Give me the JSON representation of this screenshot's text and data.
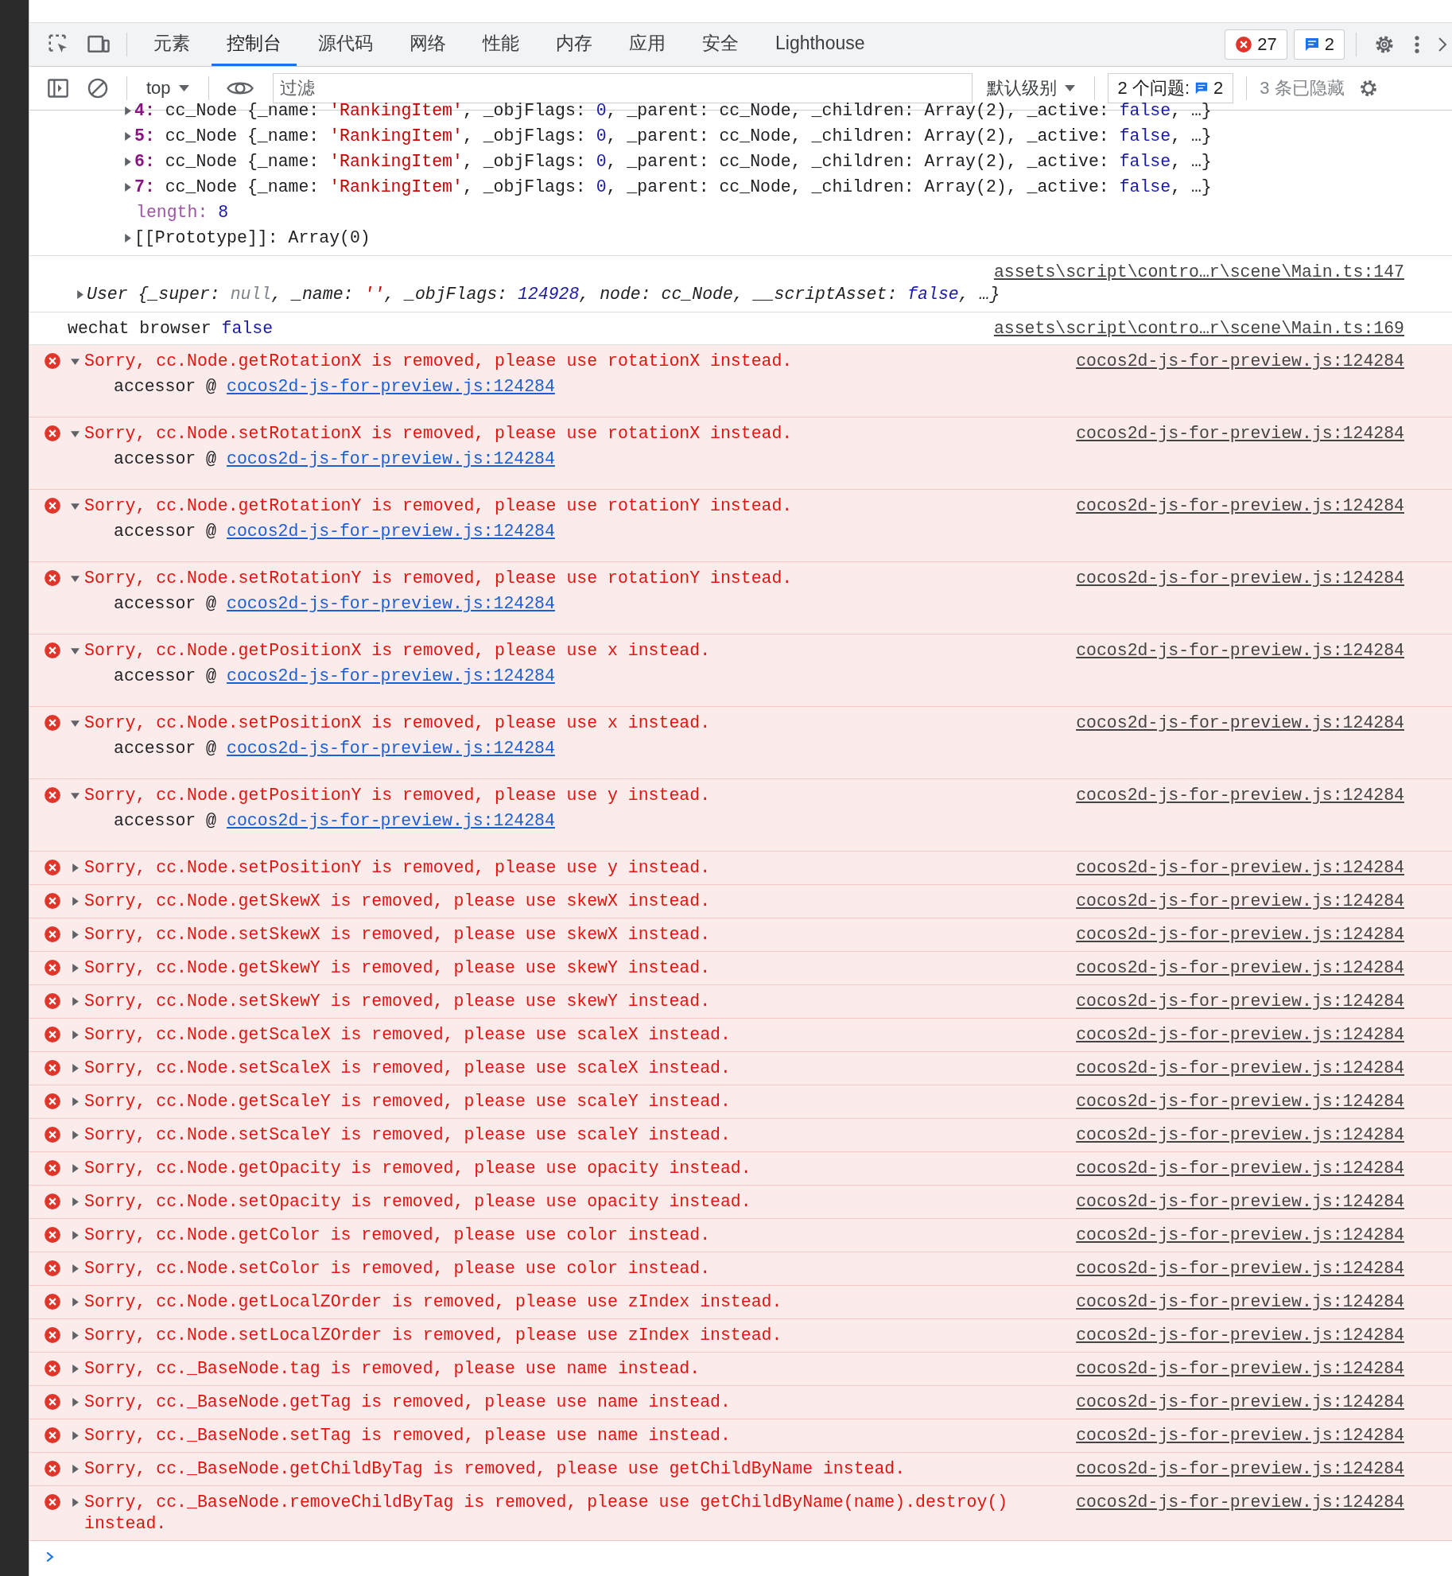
{
  "toolbar": {
    "tabs": [
      {
        "label": "元素",
        "selected": false
      },
      {
        "label": "控制台",
        "selected": true
      },
      {
        "label": "源代码",
        "selected": false
      },
      {
        "label": "网络",
        "selected": false
      },
      {
        "label": "性能",
        "selected": false
      },
      {
        "label": "内存",
        "selected": false
      },
      {
        "label": "应用",
        "selected": false
      },
      {
        "label": "安全",
        "selected": false
      },
      {
        "label": "Lighthouse",
        "selected": false
      }
    ],
    "error_count": "27",
    "message_count": "2"
  },
  "filter_bar": {
    "context": "top",
    "placeholder": "过滤",
    "level": "默认级别",
    "issues_label": "2 个问题:",
    "issues_count": "2",
    "hidden": "3 条已隐藏"
  },
  "console": {
    "entries": [
      {
        "kind": "tree",
        "lines": [
          {
            "key": "4:",
            "kind": "index",
            "expanded": false,
            "tokens": [
              {
                "kind": "plain",
                "text": " cc_Node {_name: "
              },
              {
                "kind": "string",
                "text": "'RankingItem'"
              },
              {
                "kind": "plain",
                "text": ", _objFlags: "
              },
              {
                "kind": "number",
                "text": "0"
              },
              {
                "kind": "plain",
                "text": ", _parent: cc_Node, _children: Array(2), _active: "
              },
              {
                "kind": "number",
                "text": "false"
              },
              {
                "kind": "plain",
                "text": ", …}"
              }
            ]
          },
          {
            "key": "5:",
            "kind": "index",
            "expanded": false,
            "tokens": [
              {
                "kind": "plain",
                "text": " cc_Node {_name: "
              },
              {
                "kind": "string",
                "text": "'RankingItem'"
              },
              {
                "kind": "plain",
                "text": ", _objFlags: "
              },
              {
                "kind": "number",
                "text": "0"
              },
              {
                "kind": "plain",
                "text": ", _parent: cc_Node, _children: Array(2), _active: "
              },
              {
                "kind": "number",
                "text": "false"
              },
              {
                "kind": "plain",
                "text": ", …}"
              }
            ]
          },
          {
            "key": "6:",
            "kind": "index",
            "expanded": false,
            "tokens": [
              {
                "kind": "plain",
                "text": " cc_Node {_name: "
              },
              {
                "kind": "string",
                "text": "'RankingItem'"
              },
              {
                "kind": "plain",
                "text": ", _objFlags: "
              },
              {
                "kind": "number",
                "text": "0"
              },
              {
                "kind": "plain",
                "text": ", _parent: cc_Node, _children: Array(2), _active: "
              },
              {
                "kind": "number",
                "text": "false"
              },
              {
                "kind": "plain",
                "text": ", …}"
              }
            ]
          },
          {
            "key": "7:",
            "kind": "index",
            "expanded": false,
            "tokens": [
              {
                "kind": "plain",
                "text": " cc_Node {_name: "
              },
              {
                "kind": "string",
                "text": "'RankingItem'"
              },
              {
                "kind": "plain",
                "text": ", _objFlags: "
              },
              {
                "kind": "number",
                "text": "0"
              },
              {
                "kind": "plain",
                "text": ", _parent: cc_Node, _children: Array(2), _active: "
              },
              {
                "kind": "number",
                "text": "false"
              },
              {
                "kind": "plain",
                "text": ", …}"
              }
            ]
          },
          {
            "key": "length:",
            "kind": "own",
            "tokens": [
              {
                "kind": "number",
                "text": " 8"
              }
            ]
          },
          {
            "key": "[[Prototype]]:",
            "kind": "internal",
            "expanded": false,
            "tokens": [
              {
                "kind": "plain",
                "text": " Array(0)"
              }
            ]
          }
        ]
      },
      {
        "kind": "object",
        "source": "assets\\script\\contro…r\\scene\\Main.ts:147",
        "expanded": false,
        "tokens": [
          {
            "kind": "plain",
            "text": "User {_super: "
          },
          {
            "kind": "null",
            "text": "null"
          },
          {
            "kind": "plain",
            "text": ", _name: "
          },
          {
            "kind": "string",
            "text": "''"
          },
          {
            "kind": "plain",
            "text": ", _objFlags: "
          },
          {
            "kind": "number",
            "text": "124928"
          },
          {
            "kind": "plain",
            "text": ", node: cc_Node, __scriptAsset: "
          },
          {
            "kind": "number",
            "text": "false"
          },
          {
            "kind": "plain",
            "text": ", …}"
          }
        ]
      },
      {
        "kind": "log",
        "source": "assets\\script\\contro…r\\scene\\Main.ts:169",
        "tokens": [
          {
            "kind": "plain",
            "text": "wechat browser "
          },
          {
            "kind": "number",
            "text": "false"
          }
        ]
      },
      {
        "kind": "error",
        "expanded": true,
        "message": "Sorry, cc.Node.getRotationX is removed, please use rotationX instead.",
        "source": "cocos2d-js-for-preview.js:124284",
        "stack": [
          {
            "fn": "accessor @",
            "link": "cocos2d-js-for-preview.js:124284"
          }
        ]
      },
      {
        "kind": "error",
        "expanded": true,
        "message": "Sorry, cc.Node.setRotationX is removed, please use rotationX instead.",
        "source": "cocos2d-js-for-preview.js:124284",
        "stack": [
          {
            "fn": "accessor @",
            "link": "cocos2d-js-for-preview.js:124284"
          }
        ]
      },
      {
        "kind": "error",
        "expanded": true,
        "message": "Sorry, cc.Node.getRotationY is removed, please use rotationY instead.",
        "source": "cocos2d-js-for-preview.js:124284",
        "stack": [
          {
            "fn": "accessor @",
            "link": "cocos2d-js-for-preview.js:124284"
          }
        ]
      },
      {
        "kind": "error",
        "expanded": true,
        "message": "Sorry, cc.Node.setRotationY is removed, please use rotationY instead.",
        "source": "cocos2d-js-for-preview.js:124284",
        "stack": [
          {
            "fn": "accessor @",
            "link": "cocos2d-js-for-preview.js:124284"
          }
        ]
      },
      {
        "kind": "error",
        "expanded": true,
        "message": "Sorry, cc.Node.getPositionX is removed, please use x instead.",
        "source": "cocos2d-js-for-preview.js:124284",
        "stack": [
          {
            "fn": "accessor @",
            "link": "cocos2d-js-for-preview.js:124284"
          }
        ]
      },
      {
        "kind": "error",
        "expanded": true,
        "message": "Sorry, cc.Node.setPositionX is removed, please use x instead.",
        "source": "cocos2d-js-for-preview.js:124284",
        "stack": [
          {
            "fn": "accessor @",
            "link": "cocos2d-js-for-preview.js:124284"
          }
        ]
      },
      {
        "kind": "error",
        "expanded": true,
        "message": "Sorry, cc.Node.getPositionY is removed, please use y instead.",
        "source": "cocos2d-js-for-preview.js:124284",
        "stack": [
          {
            "fn": "accessor @",
            "link": "cocos2d-js-for-preview.js:124284"
          }
        ]
      },
      {
        "kind": "error",
        "expanded": false,
        "message": "Sorry, cc.Node.setPositionY is removed, please use y instead.",
        "source": "cocos2d-js-for-preview.js:124284"
      },
      {
        "kind": "error",
        "expanded": false,
        "message": "Sorry, cc.Node.getSkewX is removed, please use skewX instead.",
        "source": "cocos2d-js-for-preview.js:124284"
      },
      {
        "kind": "error",
        "expanded": false,
        "message": "Sorry, cc.Node.setSkewX is removed, please use skewX instead.",
        "source": "cocos2d-js-for-preview.js:124284"
      },
      {
        "kind": "error",
        "expanded": false,
        "message": "Sorry, cc.Node.getSkewY is removed, please use skewY instead.",
        "source": "cocos2d-js-for-preview.js:124284"
      },
      {
        "kind": "error",
        "expanded": false,
        "message": "Sorry, cc.Node.setSkewY is removed, please use skewY instead.",
        "source": "cocos2d-js-for-preview.js:124284"
      },
      {
        "kind": "error",
        "expanded": false,
        "message": "Sorry, cc.Node.getScaleX is removed, please use scaleX instead.",
        "source": "cocos2d-js-for-preview.js:124284"
      },
      {
        "kind": "error",
        "expanded": false,
        "message": "Sorry, cc.Node.setScaleX is removed, please use scaleX instead.",
        "source": "cocos2d-js-for-preview.js:124284"
      },
      {
        "kind": "error",
        "expanded": false,
        "message": "Sorry, cc.Node.getScaleY is removed, please use scaleY instead.",
        "source": "cocos2d-js-for-preview.js:124284"
      },
      {
        "kind": "error",
        "expanded": false,
        "message": "Sorry, cc.Node.setScaleY is removed, please use scaleY instead.",
        "source": "cocos2d-js-for-preview.js:124284"
      },
      {
        "kind": "error",
        "expanded": false,
        "message": "Sorry, cc.Node.getOpacity is removed, please use opacity instead.",
        "source": "cocos2d-js-for-preview.js:124284"
      },
      {
        "kind": "error",
        "expanded": false,
        "message": "Sorry, cc.Node.setOpacity is removed, please use opacity instead.",
        "source": "cocos2d-js-for-preview.js:124284"
      },
      {
        "kind": "error",
        "expanded": false,
        "message": "Sorry, cc.Node.getColor is removed, please use color instead.",
        "source": "cocos2d-js-for-preview.js:124284"
      },
      {
        "kind": "error",
        "expanded": false,
        "message": "Sorry, cc.Node.setColor is removed, please use color instead.",
        "source": "cocos2d-js-for-preview.js:124284"
      },
      {
        "kind": "error",
        "expanded": false,
        "message": "Sorry, cc.Node.getLocalZOrder is removed, please use zIndex instead.",
        "source": "cocos2d-js-for-preview.js:124284"
      },
      {
        "kind": "error",
        "expanded": false,
        "message": "Sorry, cc.Node.setLocalZOrder is removed, please use zIndex instead.",
        "source": "cocos2d-js-for-preview.js:124284"
      },
      {
        "kind": "error",
        "expanded": false,
        "message": "Sorry, cc._BaseNode.tag is removed, please use name instead.",
        "source": "cocos2d-js-for-preview.js:124284"
      },
      {
        "kind": "error",
        "expanded": false,
        "message": "Sorry, cc._BaseNode.getTag is removed, please use name instead.",
        "source": "cocos2d-js-for-preview.js:124284"
      },
      {
        "kind": "error",
        "expanded": false,
        "message": "Sorry, cc._BaseNode.setTag is removed, please use name instead.",
        "source": "cocos2d-js-for-preview.js:124284"
      },
      {
        "kind": "error",
        "expanded": false,
        "message": "Sorry, cc._BaseNode.getChildByTag is removed, please use getChildByName instead.",
        "source": "cocos2d-js-for-preview.js:124284"
      },
      {
        "kind": "error",
        "expanded": false,
        "message": "Sorry, cc._BaseNode.removeChildByTag is removed, please use getChildByName(name).destroy() instead.",
        "source": "cocos2d-js-for-preview.js:124284"
      }
    ]
  }
}
